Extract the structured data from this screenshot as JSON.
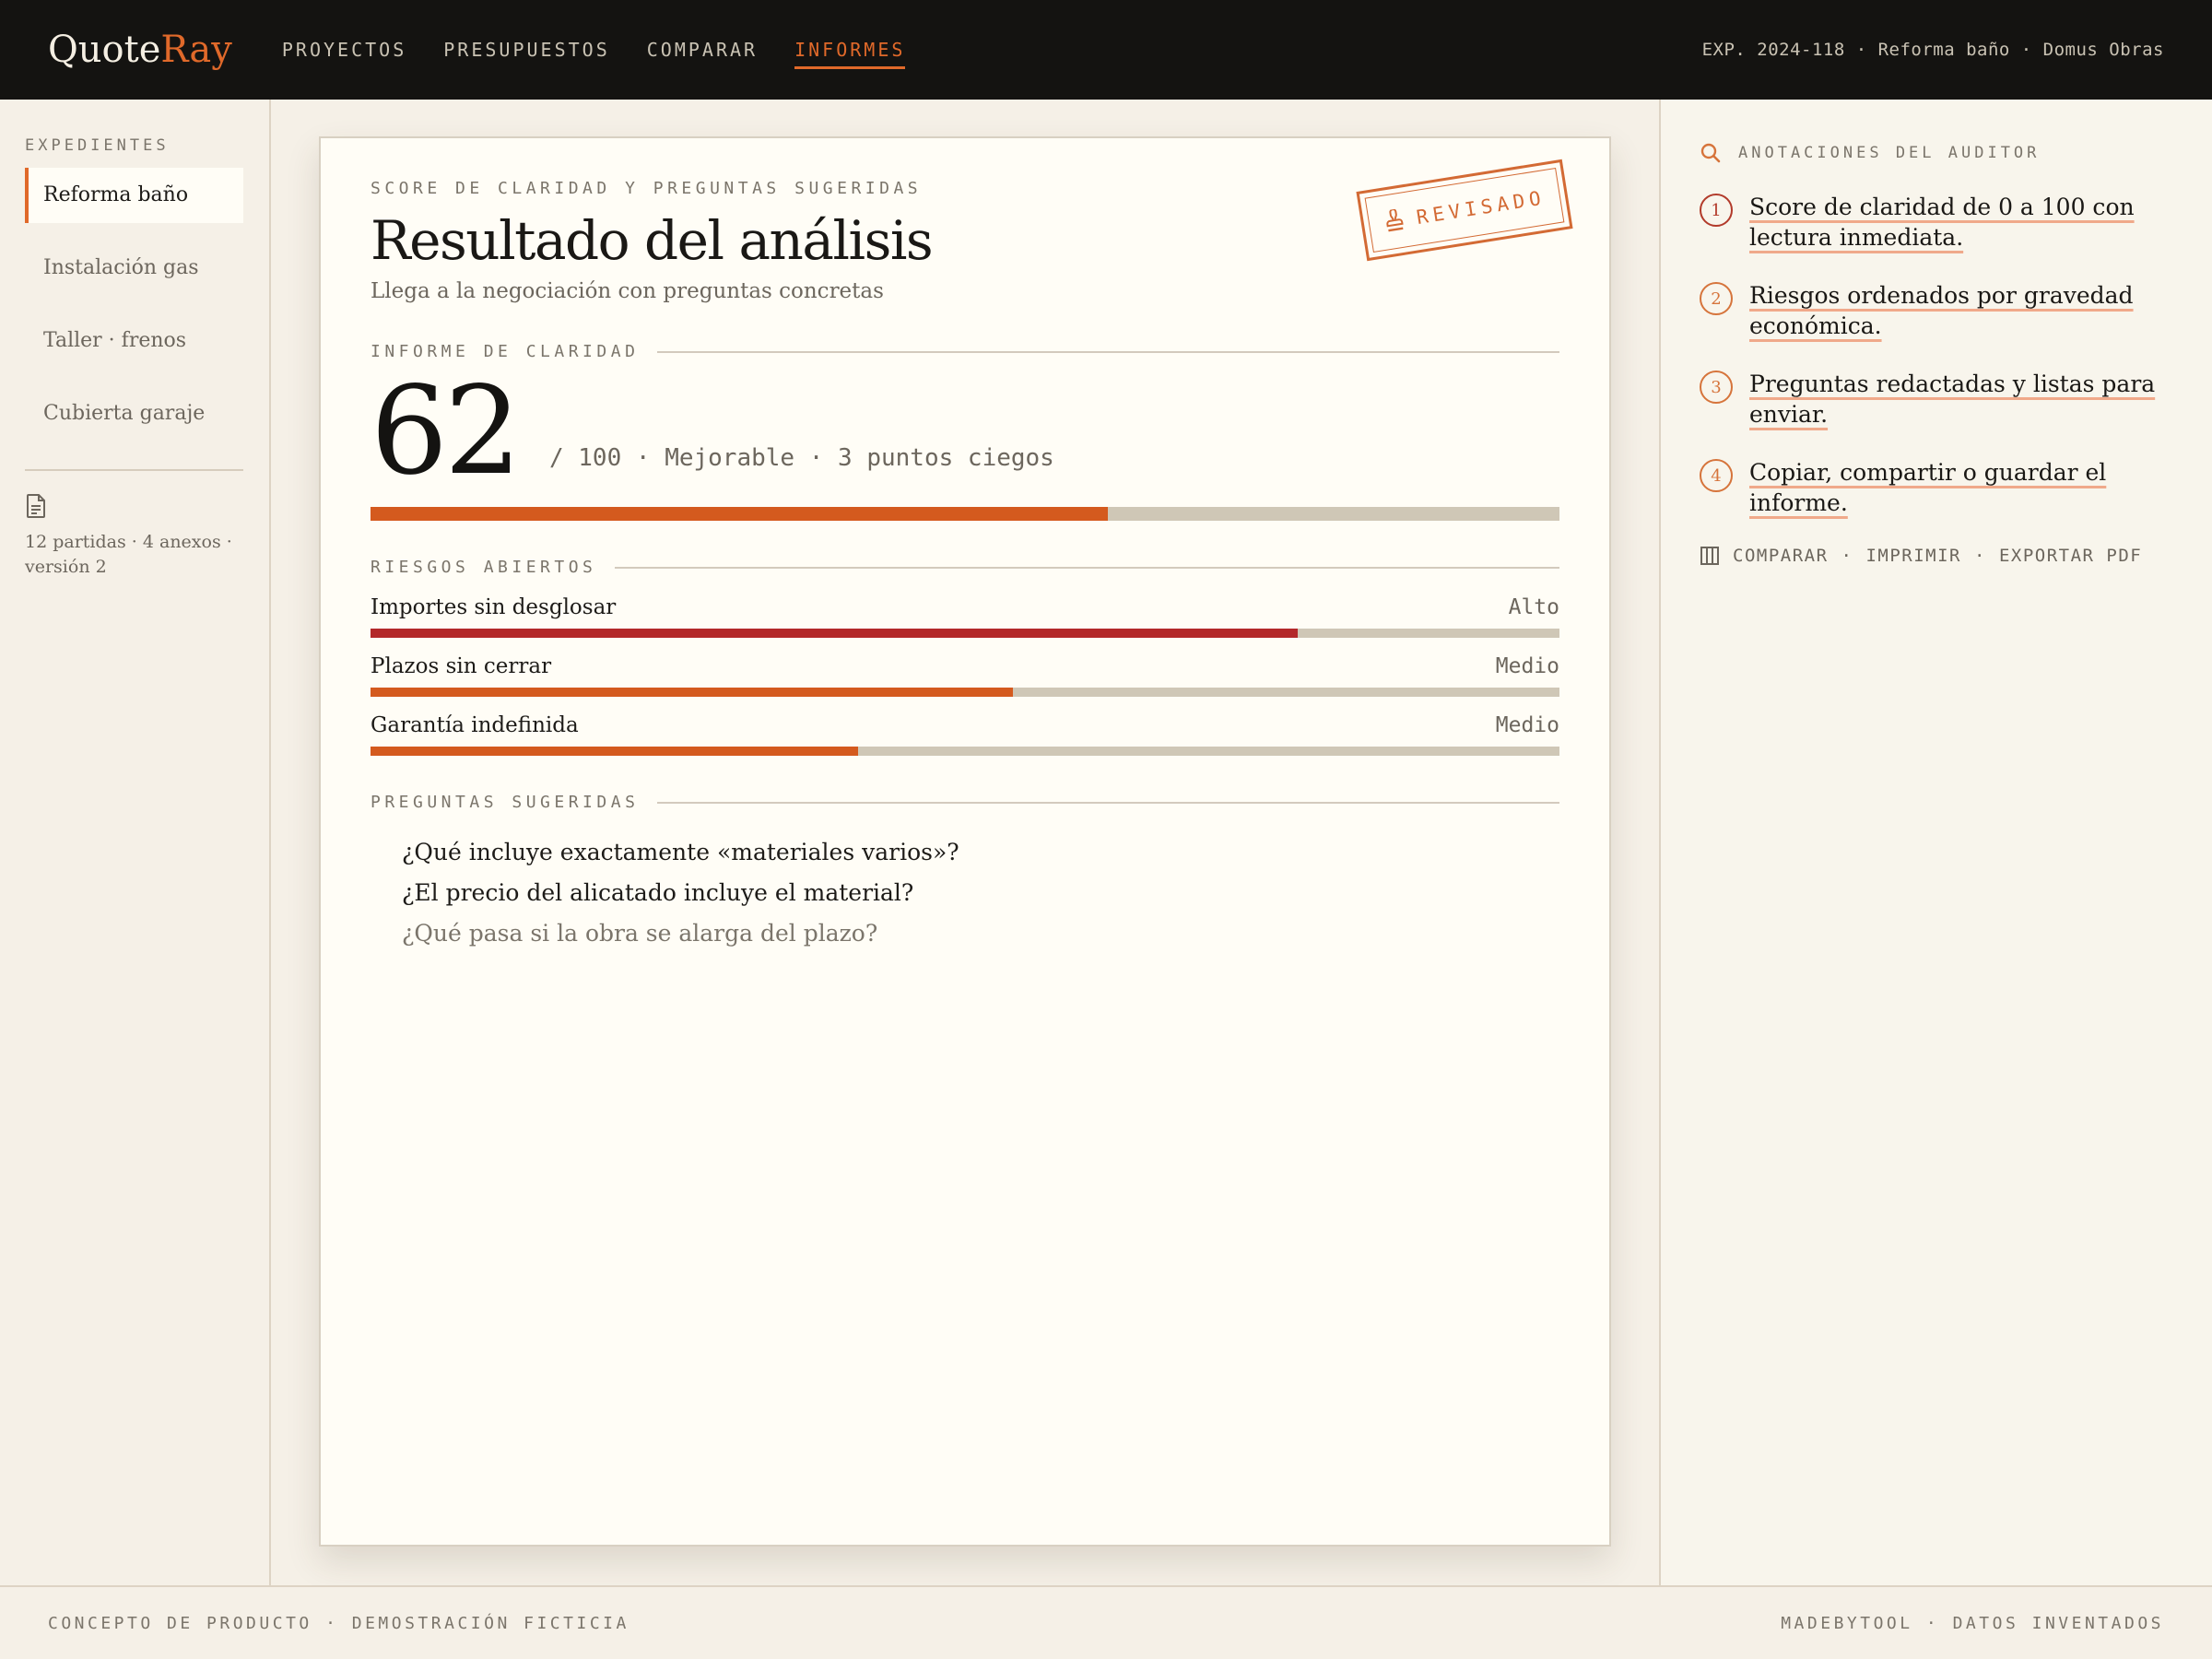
{
  "app": {
    "logo_part1": "Quote",
    "logo_part2": "Ray",
    "accent_color": "#e0692a"
  },
  "nav": {
    "items": [
      {
        "label": "PROYECTOS",
        "active": false
      },
      {
        "label": "PRESUPUESTOS",
        "active": false
      },
      {
        "label": "COMPARAR",
        "active": false
      },
      {
        "label": "INFORMES",
        "active": true
      }
    ],
    "meta": "EXP. 2024-118 · Reforma baño · Domus Obras"
  },
  "sidebar": {
    "heading": "EXPEDIENTES",
    "items": [
      {
        "label": "Reforma baño",
        "active": true
      },
      {
        "label": "Instalación gas",
        "active": false
      },
      {
        "label": "Taller · frenos",
        "active": false
      },
      {
        "label": "Cubierta garaje",
        "active": false
      }
    ],
    "file_icon": "document-icon",
    "meta_line1": "12 partidas · 4 anexos ·",
    "meta_line2": "versión 2"
  },
  "report": {
    "eyebrow": "SCORE DE CLARIDAD Y PREGUNTAS SUGERIDAS",
    "title": "Resultado del análisis",
    "subtitle": "Llega a la negociación con preguntas concretas",
    "stamp": {
      "icon": "stamp-icon",
      "label": "REVISADO"
    },
    "clarity_heading": "INFORME DE CLARIDAD",
    "score": 62,
    "score_max": 100,
    "score_meta": "/ 100 · Mejorable · 3 puntos ciegos",
    "risks_heading": "RIESGOS ABIERTOS",
    "risks": [
      {
        "label": "Importes sin desglosar",
        "level": "Alto",
        "fraction": 0.78,
        "color": "#b3282a"
      },
      {
        "label": "Plazos sin cerrar",
        "level": "Medio",
        "fraction": 0.54,
        "color": "#d45a1e"
      },
      {
        "label": "Garantía indefinida",
        "level": "Medio",
        "fraction": 0.41,
        "color": "#d45a1e"
      }
    ],
    "questions_heading": "PREGUNTAS SUGERIDAS",
    "questions": [
      {
        "text": "¿Qué incluye exactamente «materiales varios»?",
        "muted": false
      },
      {
        "text": "¿El precio del alicatado incluye el material?",
        "muted": false
      },
      {
        "text": "¿Qué pasa si la obra se alarga del plazo?",
        "muted": true
      }
    ]
  },
  "auditor": {
    "heading": "ANOTACIONES DEL AUDITOR",
    "heading_icon": "search-icon",
    "notes": [
      {
        "num": "1",
        "text": "Score de claridad de 0 a 100 con lectura inmediata."
      },
      {
        "num": "2",
        "text": "Riesgos ordenados por gravedad económica."
      },
      {
        "num": "3",
        "text": "Preguntas redactadas y listas para enviar."
      },
      {
        "num": "4",
        "text": "Copiar, compartir o guardar el informe."
      }
    ],
    "actions_icon": "columns-icon",
    "actions": [
      "COMPARAR",
      "IMPRIMIR",
      "EXPORTAR PDF"
    ]
  },
  "footer": {
    "left": "CONCEPTO DE PRODUCTO · DEMOSTRACIÓN FICTICIA",
    "right": "MADEBYTOOL · DATOS INVENTADOS"
  }
}
